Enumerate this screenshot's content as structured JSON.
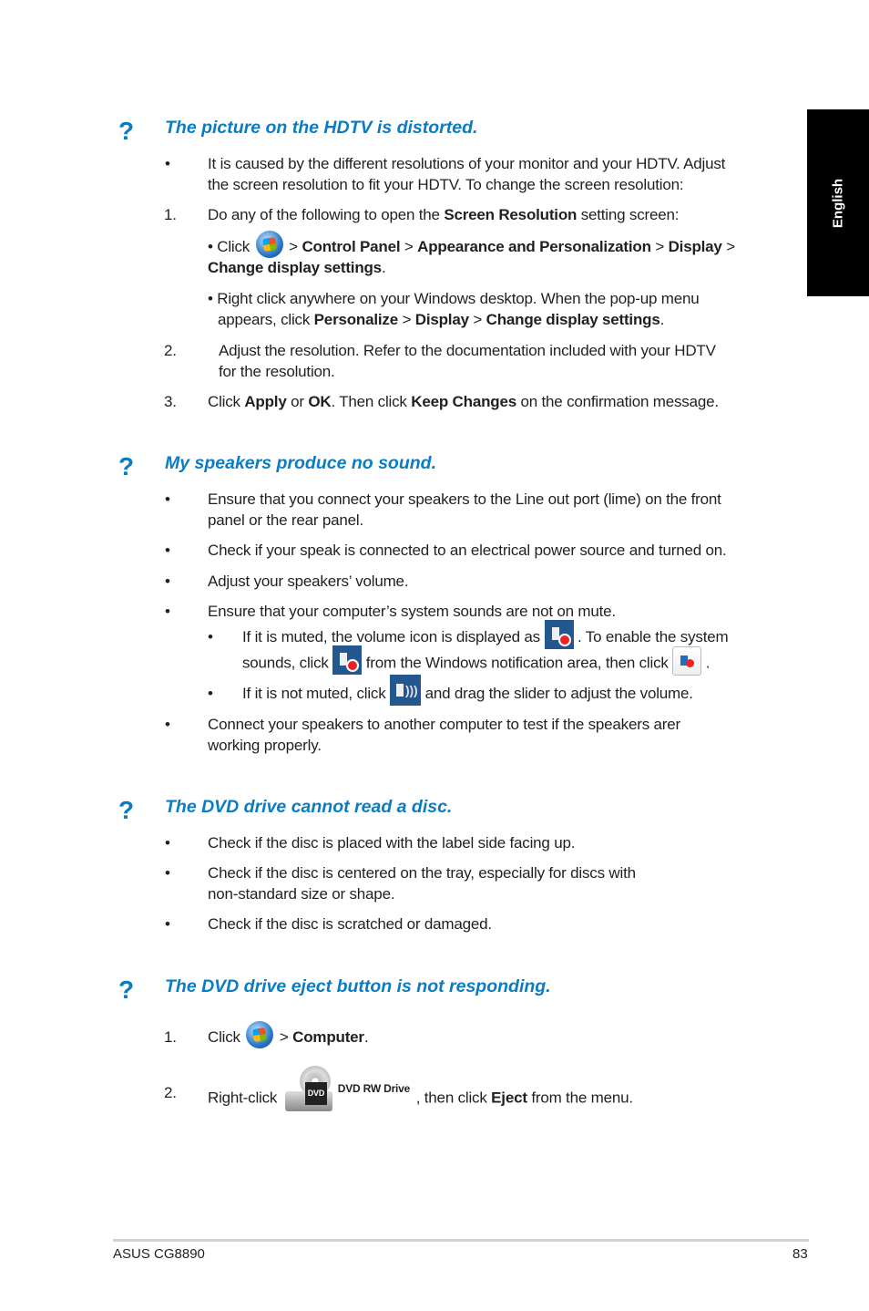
{
  "side_tab": {
    "label": "English"
  },
  "sections": [
    {
      "heading": "The picture on the HDTV is distorted.",
      "intro_bullet": [
        "It is caused by the different resolutions of your monitor and your HDTV. Adjust",
        "the screen resolution to fit your HDTV. To change the screen resolution:"
      ],
      "step1": {
        "num": "1.",
        "pre": "Do any of the following to open the ",
        "bold": "Screen Resolution",
        "post": " setting screen:"
      },
      "option_a": {
        "pre": "• Click",
        "p1": "Control Panel",
        "p2": "Appearance and Personalization",
        "p3": "Display",
        "p4": "Change display settings",
        "sep": ">",
        "end": "."
      },
      "option_b": {
        "l1": "• Right click anywhere on your Windows desktop. When the pop-up menu",
        "l2pre": "appears, click ",
        "p1": "Personalize",
        "p2": "Display",
        "p3": "Change display settings",
        "sep": ">",
        "end": "."
      },
      "step2": {
        "num": "2.",
        "l1": "Adjust the resolution. Refer to the documentation included with your HDTV",
        "l2": "for the resolution."
      },
      "step3": {
        "num": "3.",
        "t1": "Click ",
        "b1": "Apply",
        "t2": " or ",
        "b2": "OK",
        "t3": ". Then click ",
        "b3": "Keep Changes",
        "t4": " on the confirmation message."
      }
    },
    {
      "heading": "My speakers produce no sound.",
      "bullets": [
        [
          "Ensure that you connect your speakers to the Line out port (lime) on the front",
          "panel or the rear panel."
        ],
        [
          "Check if your speak is connected to an electrical power source and turned on."
        ],
        [
          "Adjust your speakers’ volume."
        ],
        [
          "Ensure that your computer’s system sounds are not on mute."
        ]
      ],
      "sub_a": {
        "t1": "If it is muted, the volume icon is displayed as",
        "t2": ". To enable the system",
        "t3": "sounds, click",
        "t4": "from the Windows notification area, then click",
        "t5": "."
      },
      "sub_b": {
        "t1": "If it is not muted, click",
        "t2": "and drag the slider to adjust the volume."
      },
      "last_bullet": [
        "Connect your speakers to another computer to test if the speakers arer",
        "working properly."
      ]
    },
    {
      "heading": "The DVD drive cannot read a disc.",
      "bullets": [
        [
          "Check if the disc is placed with the label side facing up."
        ],
        [
          "Check if the disc is centered on the tray, especially for discs with",
          "non-standard size or shape."
        ],
        [
          "Check if the disc is scratched or damaged."
        ]
      ]
    },
    {
      "heading": "The DVD drive eject button is not responding.",
      "step1": {
        "num": "1.",
        "pre": "Click",
        "sep": ">",
        "bold": "Computer",
        "end": "."
      },
      "step2": {
        "num": "2.",
        "pre": "Right-click",
        "drive_label": "DVD RW Drive",
        "drive_badge": "DVD",
        "mid": ", then click ",
        "bold": "Eject",
        "end": " from the menu."
      }
    }
  ],
  "bullet_char": "•",
  "question_mark": "?",
  "footer": {
    "model": "ASUS CG8890",
    "page": "83"
  }
}
